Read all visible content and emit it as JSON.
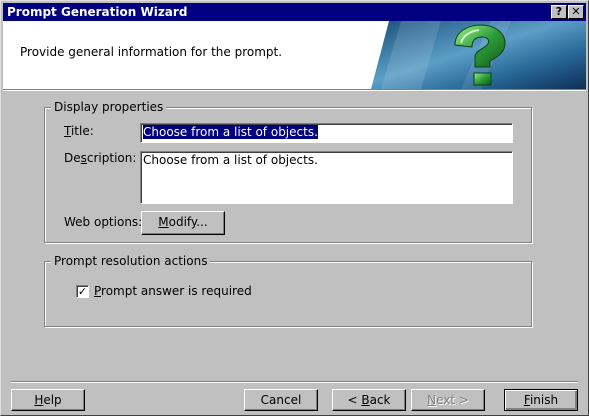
{
  "window": {
    "title": "Prompt Generation Wizard",
    "help_glyph": "?",
    "close_glyph": "✕"
  },
  "header": {
    "subtitle": "Provide general information for the prompt."
  },
  "display_properties": {
    "group_label": "Display properties",
    "title_label_mnemonic": "T",
    "title_label_rest": "itle:",
    "title_value": "Choose from a list of objects.",
    "description_label_pre": "De",
    "description_label_mnemonic": "s",
    "description_label_post": "cription:",
    "description_value": "Choose from a list of objects.",
    "web_options_label": "Web options:",
    "modify_button_mnemonic": "M",
    "modify_button_rest": "odify..."
  },
  "resolution": {
    "group_label": "Prompt resolution actions",
    "required_checked": true,
    "required_mnemonic": "P",
    "required_rest": "rompt answer is required"
  },
  "footer": {
    "help_mnemonic": "H",
    "help_rest": "elp",
    "cancel_label": "Cancel",
    "back_prefix": "< ",
    "back_mnemonic": "B",
    "back_rest": "ack",
    "next_mnemonic": "N",
    "next_rest": "ext >",
    "finish_mnemonic": "F",
    "finish_rest": "inish"
  },
  "colors": {
    "titlebar": "#000080",
    "face": "#c0c0c0",
    "selection": "#000080",
    "banner_accent": "#2e9e3a"
  }
}
